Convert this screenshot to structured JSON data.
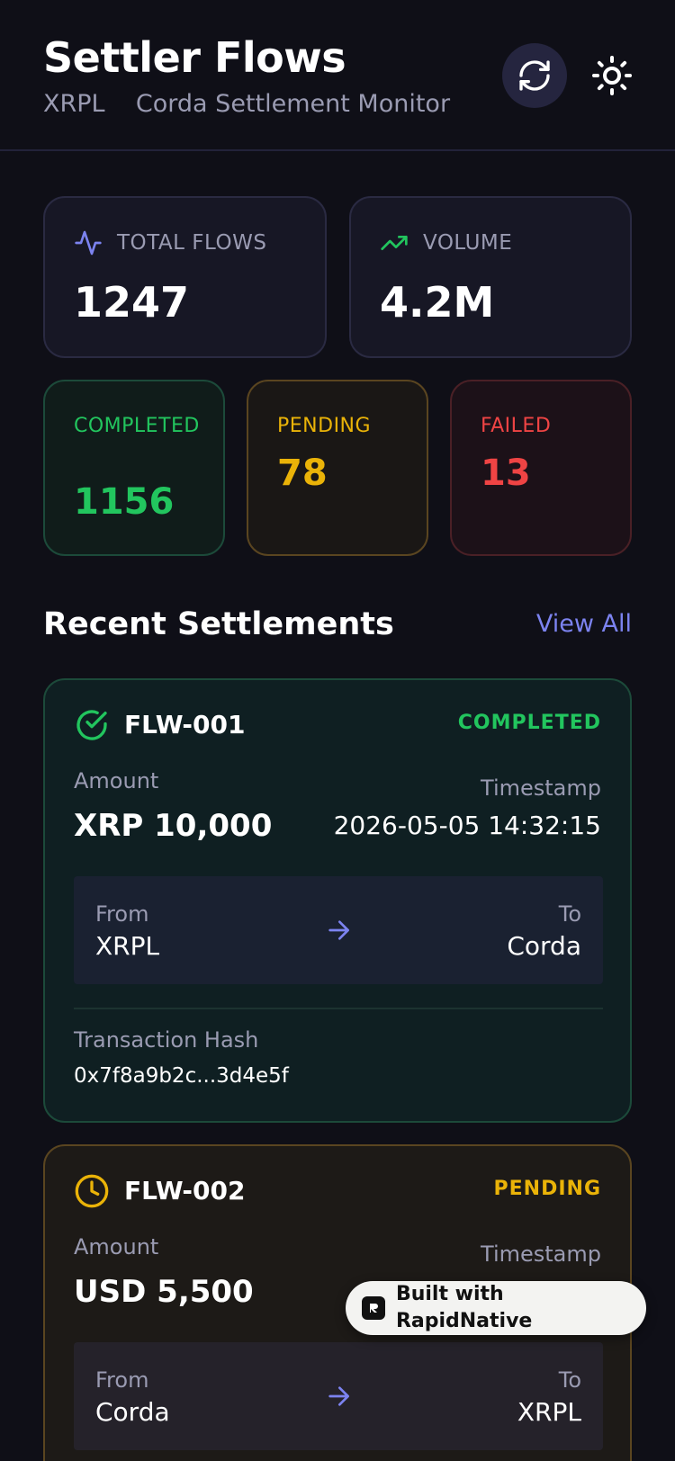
{
  "header": {
    "title": "Settler Flows",
    "subtitle": "XRPL    Corda Settlement Monitor",
    "refresh_icon": "refresh-icon",
    "theme_icon": "sun-icon"
  },
  "stats": {
    "total_flows": {
      "label": "TOTAL FLOWS",
      "value": "1247",
      "icon": "activity-icon"
    },
    "volume": {
      "label": "VOLUME",
      "value": "4.2M",
      "icon": "trending-up-icon"
    },
    "completed": {
      "label": "COMPLETED",
      "value": "1156"
    },
    "pending": {
      "label": "PENDING",
      "value": "78"
    },
    "failed": {
      "label": "FAILED",
      "value": "13"
    }
  },
  "section": {
    "title": "Recent Settlements",
    "view_all": "View All"
  },
  "flows": [
    {
      "id": "FLW-001",
      "status": "COMPLETED",
      "status_icon": "check-circle-icon",
      "amount_label": "Amount",
      "amount": "XRP 10,000",
      "timestamp_label": "Timestamp",
      "timestamp": "2026-05-05 14:32:15",
      "from_label": "From",
      "from": "XRPL",
      "to_label": "To",
      "to": "Corda",
      "hash_label": "Transaction Hash",
      "hash": "0x7f8a9b2c...3d4e5f"
    },
    {
      "id": "FLW-002",
      "status": "PENDING",
      "status_icon": "clock-icon",
      "amount_label": "Amount",
      "amount": "USD 5,500",
      "timestamp_label": "Timestamp",
      "from_label": "From",
      "from": "Corda",
      "to_label": "To",
      "to": "XRPL"
    }
  ],
  "badge": {
    "text": "Built with RapidNative"
  },
  "colors": {
    "background": "#0f0f17",
    "accent": "#7c83f0",
    "completed": "#22c55e",
    "pending": "#eab308",
    "failed": "#ef4444"
  }
}
